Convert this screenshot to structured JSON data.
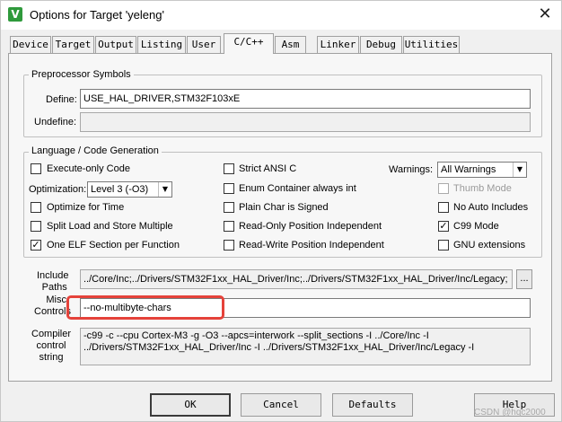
{
  "window": {
    "title": "Options for Target 'yeleng'",
    "icon_letter": "V",
    "app_icon": "keil-uvision-icon",
    "close_glyph": "✕"
  },
  "tabs": [
    {
      "label": "Device",
      "active": false
    },
    {
      "label": "Target",
      "active": false
    },
    {
      "label": "Output",
      "active": false
    },
    {
      "label": "Listing",
      "active": false
    },
    {
      "label": "User",
      "active": false
    },
    {
      "label": "C/C++",
      "active": true
    },
    {
      "label": "Asm",
      "active": false
    },
    {
      "label": "Linker",
      "active": false
    },
    {
      "label": "Debug",
      "active": false
    },
    {
      "label": "Utilities",
      "active": false
    }
  ],
  "preprocessor": {
    "title": "Preprocessor Symbols",
    "define_label": "Define:",
    "define_value": "USE_HAL_DRIVER,STM32F103xE",
    "undefine_label": "Undefine:",
    "undefine_value": ""
  },
  "language": {
    "title": "Language / Code Generation",
    "options": {
      "execute_only": {
        "label": "Execute-only Code",
        "checked": false
      },
      "optimize_time": {
        "label": "Optimize for Time",
        "checked": false
      },
      "split_load_store": {
        "label": "Split Load and Store Multiple",
        "checked": false
      },
      "one_elf": {
        "label": "One ELF Section per Function",
        "checked": true
      },
      "strict_ansi": {
        "label": "Strict ANSI C",
        "checked": false
      },
      "enum_container": {
        "label": "Enum Container always int",
        "checked": false
      },
      "plain_char": {
        "label": "Plain Char is Signed",
        "checked": false
      },
      "ro_position": {
        "label": "Read-Only Position Independent",
        "checked": false
      },
      "rw_position": {
        "label": "Read-Write Position Independent",
        "checked": false
      },
      "thumb_mode": {
        "label": "Thumb Mode",
        "checked": false,
        "disabled": true
      },
      "no_auto_includes": {
        "label": "No Auto Includes",
        "checked": false
      },
      "c99_mode": {
        "label": "C99 Mode",
        "checked": true
      },
      "gnu_extensions": {
        "label": "GNU extensions",
        "checked": false
      }
    },
    "optimization_label": "Optimization:",
    "optimization_value": "Level 3 (-O3)",
    "warnings_label": "Warnings:",
    "warnings_value": "All Warnings",
    "check_glyph": "✓"
  },
  "include_paths": {
    "label_line1": "Include",
    "label_line2": "Paths",
    "value": "../Core/Inc;../Drivers/STM32F1xx_HAL_Driver/Inc;../Drivers/STM32F1xx_HAL_Driver/Inc/Legacy;",
    "browse_label": "..."
  },
  "misc_controls": {
    "label_line1": "Misc",
    "label_line2": "Controls",
    "value": "--no-multibyte-chars",
    "highlight_color": "#e5423a"
  },
  "compiler_string": {
    "label_line1": "Compiler",
    "label_line2": "control",
    "label_line3": "string",
    "line1": "-c99 -c --cpu Cortex-M3 -g -O3 --apcs=interwork --split_sections -I ../Core/Inc -I",
    "line2": "../Drivers/STM32F1xx_HAL_Driver/Inc -I ../Drivers/STM32F1xx_HAL_Driver/Inc/Legacy -I"
  },
  "buttons": {
    "ok": "OK",
    "cancel": "Cancel",
    "defaults": "Defaults",
    "help": "Help"
  },
  "watermark": "CSDN @hqc2000"
}
